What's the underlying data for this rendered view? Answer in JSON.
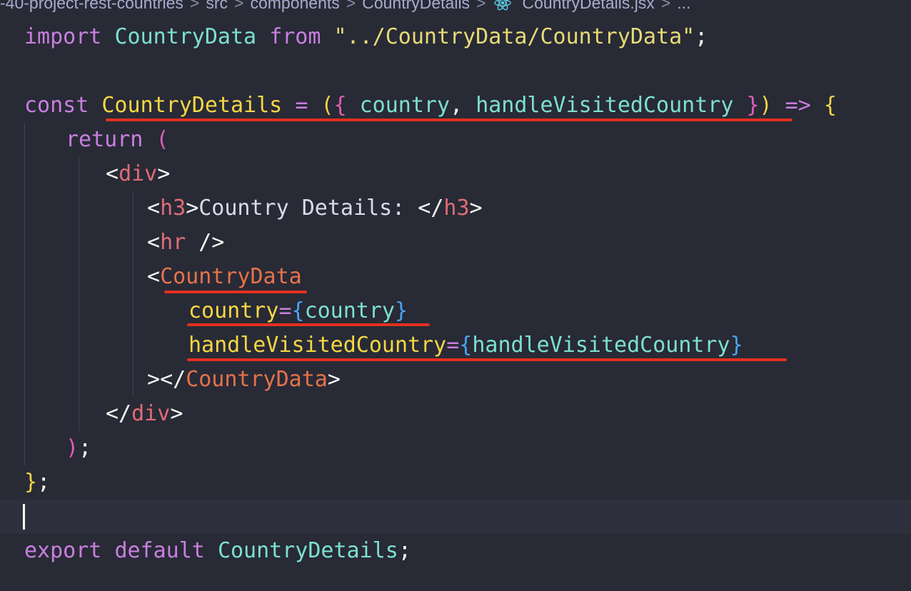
{
  "breadcrumb": {
    "items": [
      "-40-project-rest-countries",
      "src",
      "components",
      "CountryDetails",
      "CountryDetails.jsx",
      "..."
    ],
    "separator": ">"
  },
  "file_icon": "react-icon",
  "code": {
    "l1": {
      "import": "import",
      "name": "CountryData",
      "from": "from",
      "path": "\"../CountryData/CountryData\"",
      "semi": ";"
    },
    "l3": {
      "const": "const",
      "name": "CountryDetails",
      "eq": "=",
      "open_paren": "(",
      "open_brace": "{",
      "p1": "country",
      "comma": ",",
      "p2": "handleVisitedCountry",
      "close_brace": "}",
      "close_paren": ")",
      "arrow": "=>",
      "body_brace": "{"
    },
    "l4": {
      "return": "return",
      "paren": "("
    },
    "l5": {
      "lt": "<",
      "tag": "div",
      "gt": ">"
    },
    "l6": {
      "lt": "<",
      "tag": "h3",
      "gt": ">",
      "text": "Country Details: ",
      "close_lt": "</",
      "close_tag": "h3",
      "close_gt": ">"
    },
    "l7": {
      "lt": "<",
      "tag": "hr",
      "end": " />"
    },
    "l8": {
      "lt": "<",
      "tag": "CountryData"
    },
    "l9": {
      "attr": "country",
      "eq": "=",
      "lb": "{",
      "val": "country",
      "rb": "}"
    },
    "l10": {
      "attr": "handleVisitedCountry",
      "eq": "=",
      "lb": "{",
      "val": "handleVisitedCountry",
      "rb": "}"
    },
    "l11": {
      "gt": ">",
      "close_lt": "</",
      "close_tag": "CountryData",
      "close_gt": ">"
    },
    "l12": {
      "close_lt": "</",
      "tag": "div",
      "gt": ">"
    },
    "l13": {
      "paren": ")",
      "semi": ";"
    },
    "l14": {
      "brace": "}",
      "semi": ";"
    },
    "l16": {
      "export": "export",
      "default": "default",
      "name": "CountryDetails",
      "semi": ";"
    }
  },
  "colors": {
    "background": "#282a36",
    "keyword": "#c97fe0",
    "type": "#7ce0cf",
    "tag": "#e06c75",
    "component": "#e5734a",
    "attribute": "#f6d743",
    "annotation_underline": "#e3301f"
  }
}
